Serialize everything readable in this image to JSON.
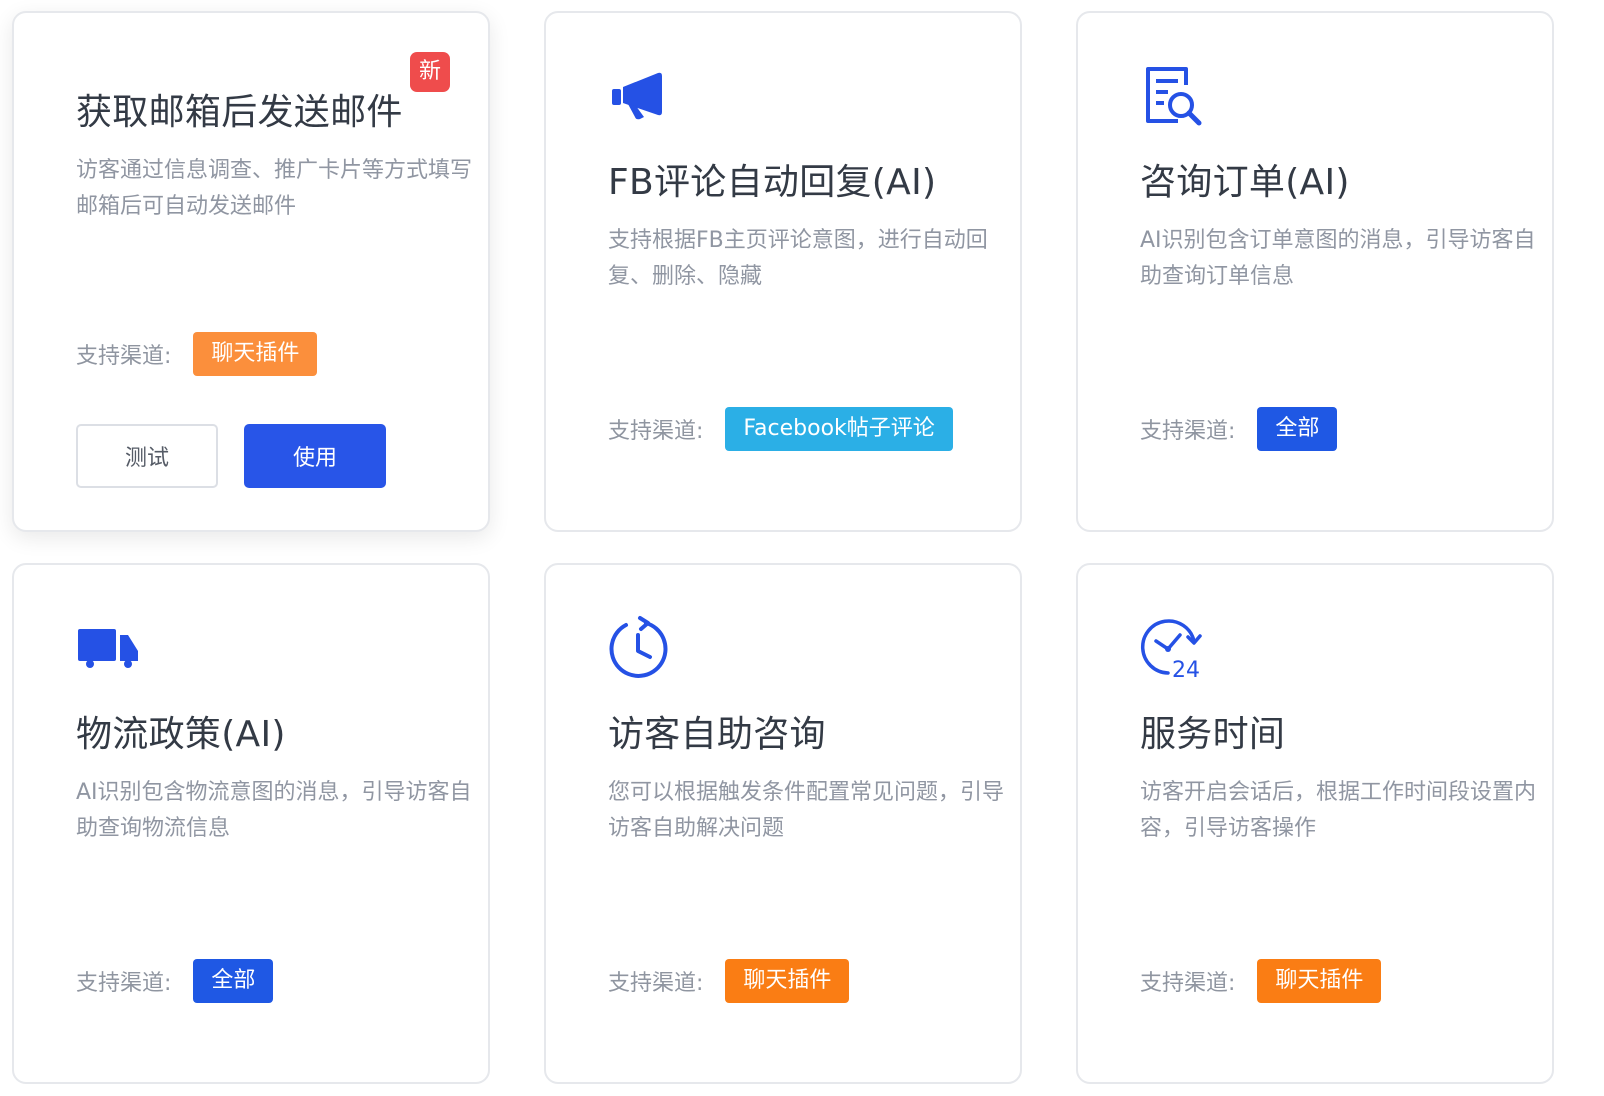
{
  "colors": {
    "accent_blue": "#2855e8",
    "icon_blue": "#2551e5",
    "tag_orange": "#fa7d14",
    "tag_cyan": "#2bafe6",
    "tag_blue": "#1f58e4",
    "badge_red": "#ef4c4c"
  },
  "cards": [
    {
      "title": "获取邮箱后发送邮件",
      "badge": "新",
      "description": "访客通过信息调查、推广卡片等方式填写邮箱后可自动发送邮件",
      "channel_label": "支持渠道:",
      "channel_tag": "聊天插件",
      "buttons": {
        "test": "测试",
        "use": "使用"
      }
    },
    {
      "icon": "megaphone-icon",
      "title": "FB评论自动回复(AI)",
      "description": "支持根据FB主页评论意图，进行自动回复、删除、隐藏",
      "channel_label": "支持渠道:",
      "channel_tag": "Facebook帖子评论"
    },
    {
      "icon": "document-search-icon",
      "title": "咨询订单(AI)",
      "description": "AI识别包含订单意图的消息，引导访客自助查询订单信息",
      "channel_label": "支持渠道:",
      "channel_tag": "全部"
    },
    {
      "icon": "truck-icon",
      "title": "物流政策(AI)",
      "description": "AI识别包含物流意图的消息，引导访客自助查询物流信息",
      "channel_label": "支持渠道:",
      "channel_tag": "全部"
    },
    {
      "icon": "clock-refresh-icon",
      "title": "访客自助咨询",
      "description": "您可以根据触发条件配置常见问题，引导访客自助解决问题",
      "channel_label": "支持渠道:",
      "channel_tag": "聊天插件"
    },
    {
      "icon": "clock-24-icon",
      "title": "服务时间",
      "description": "访客开启会话后，根据工作时间段设置内容，引导访客操作",
      "channel_label": "支持渠道:",
      "channel_tag": "聊天插件",
      "icon_text": "24"
    }
  ]
}
